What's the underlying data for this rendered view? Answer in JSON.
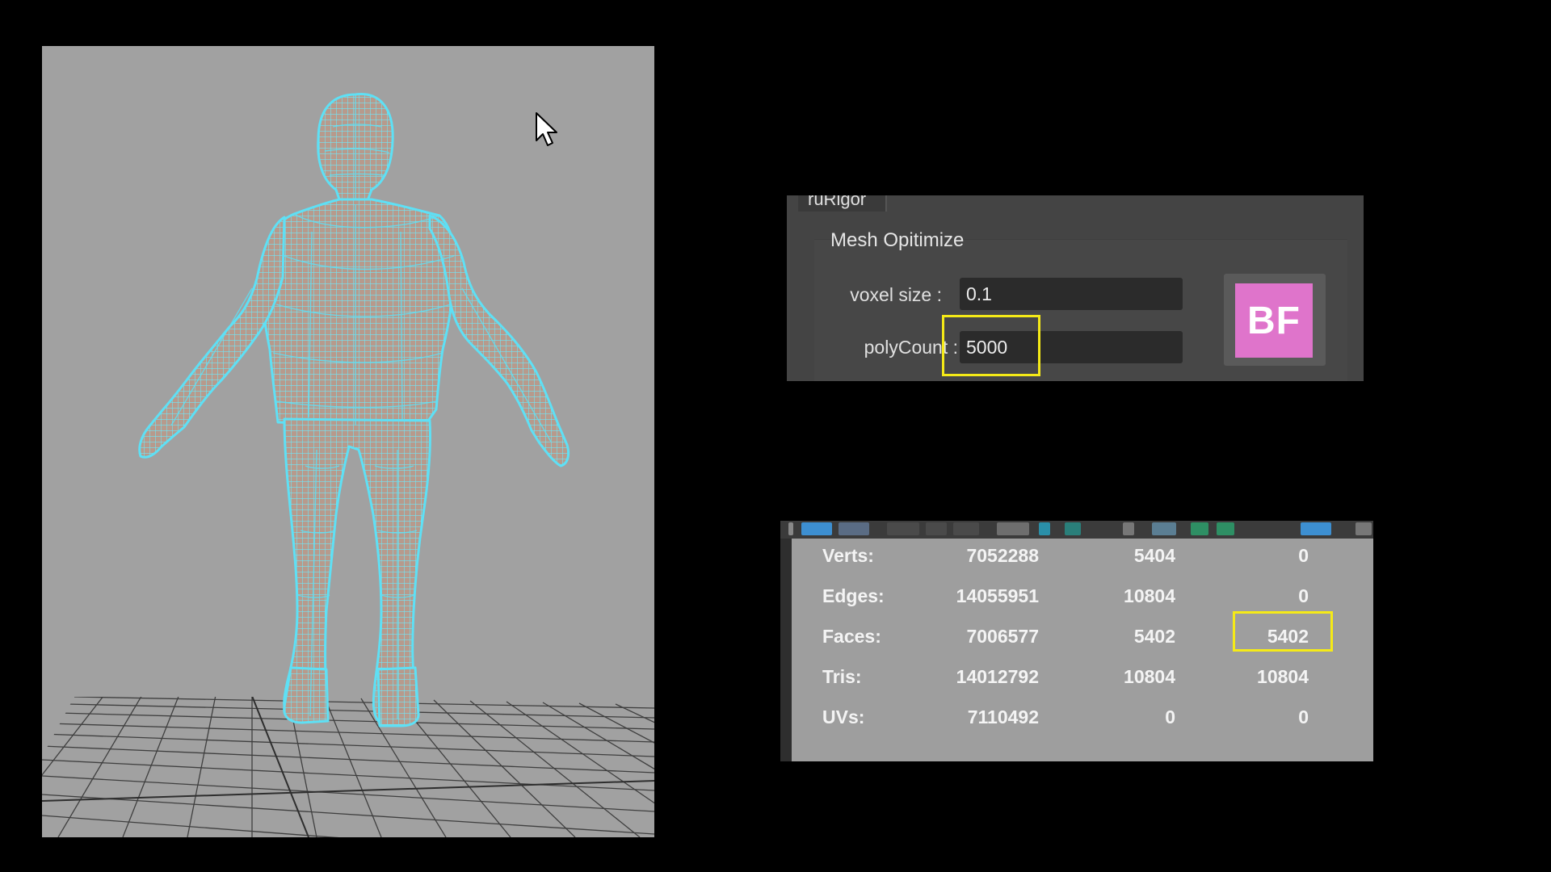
{
  "panel": {
    "tab_label": "ruRigor",
    "section_title": "Mesh Opitimize",
    "voxel_size_label": "voxel size :",
    "voxel_size_value": "0.1",
    "polycount_label": "polyCount :",
    "polycount_value": "5000",
    "button_label": "BF",
    "button_color": "#df74cb"
  },
  "stats": {
    "rows": [
      {
        "label": "Verts:",
        "values": [
          "7052288",
          "5404",
          "0"
        ]
      },
      {
        "label": "Edges:",
        "values": [
          "14055951",
          "10804",
          "0"
        ]
      },
      {
        "label": "Faces:",
        "values": [
          "7006577",
          "5402",
          "5402"
        ]
      },
      {
        "label": "Tris:",
        "values": [
          "14012792",
          "10804",
          "10804"
        ]
      },
      {
        "label": "UVs:",
        "values": [
          "7110492",
          "0",
          "0"
        ]
      }
    ]
  },
  "colors": {
    "viewport_bg": "#a1a1a1",
    "wireframe": "#5ee0f5",
    "mesh_fill": "#b5988a",
    "highlight": "#f5ea17"
  },
  "icons": [
    "mouse-pointer-icon",
    "toolbar-icons"
  ]
}
